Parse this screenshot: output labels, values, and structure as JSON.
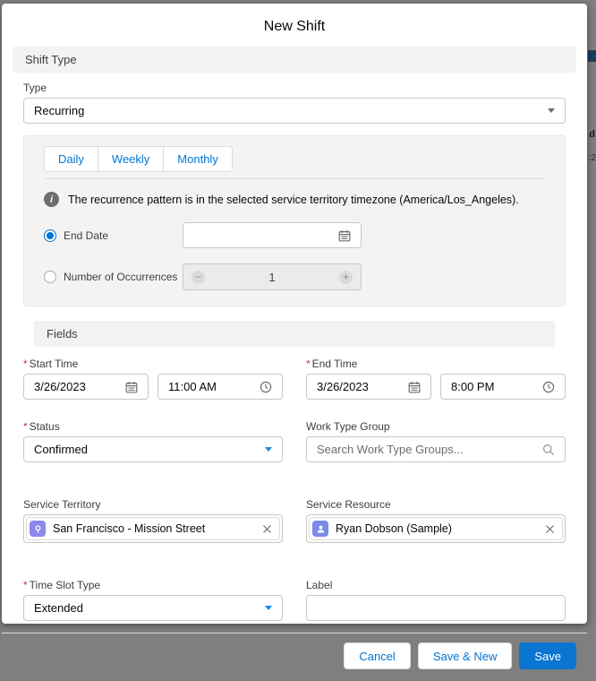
{
  "modal": {
    "title": "New Shift"
  },
  "sections": {
    "shift_type": "Shift Type",
    "fields": "Fields"
  },
  "type_field": {
    "label": "Type",
    "value": "Recurring"
  },
  "recurrence": {
    "tabs": [
      {
        "label": "Daily"
      },
      {
        "label": "Weekly"
      },
      {
        "label": "Monthly"
      }
    ],
    "info_text": "The recurrence pattern is in the selected service territory timezone (America/Los_Angeles).",
    "end_date": {
      "label": "End Date",
      "value": "",
      "selected": true
    },
    "occurrences": {
      "label": "Number of Occurrences",
      "value": "1",
      "selected": false
    }
  },
  "fields": {
    "start_time": {
      "label": "Start Time",
      "required": "*",
      "date": "3/26/2023",
      "time": "11:00 AM"
    },
    "end_time": {
      "label": "End Time",
      "required": "*",
      "date": "3/26/2023",
      "time": "8:00 PM"
    },
    "status": {
      "label": "Status",
      "required": "*",
      "value": "Confirmed"
    },
    "work_type_group": {
      "label": "Work Type Group",
      "placeholder": "Search Work Type Groups..."
    },
    "service_territory": {
      "label": "Service Territory",
      "value": "San Francisco - Mission Street"
    },
    "service_resource": {
      "label": "Service Resource",
      "value": "Ryan Dobson (Sample)"
    },
    "time_slot_type": {
      "label": "Time Slot Type",
      "required": "*",
      "value": "Extended"
    },
    "label_field": {
      "label": "Label",
      "value": ""
    }
  },
  "footer": {
    "cancel": "Cancel",
    "save_new": "Save & New",
    "save": "Save"
  },
  "icons": {
    "info_glyph": "i",
    "minus_glyph": "−",
    "plus_glyph": "+"
  },
  "background_fragments": {
    "text_top": "d",
    "text_bottom": ":2"
  },
  "colors": {
    "accent_blue": "#0176d3",
    "save_button": "#0b76d2",
    "required_red": "#c23934",
    "info_icon_gray": "#706e6b",
    "territory_icon": "#8a87ee",
    "resource_icon": "#7a8ae8",
    "backdrop_gray": "#7f7f7f",
    "section_bg": "#f3f2f2"
  }
}
